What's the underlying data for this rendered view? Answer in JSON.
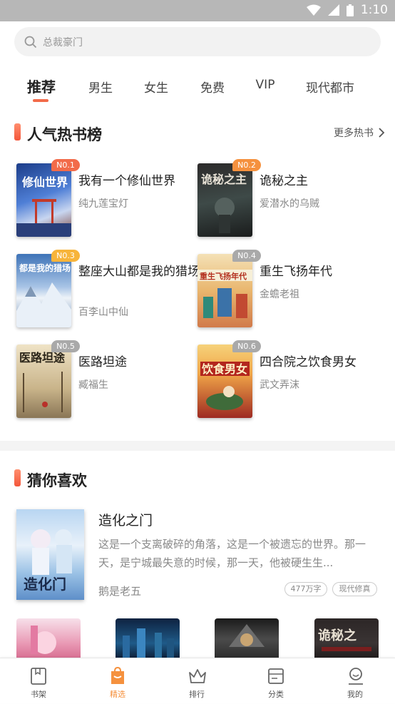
{
  "status_bar": {
    "time": "1:10"
  },
  "search": {
    "placeholder": "总裁豪门"
  },
  "tabs": [
    {
      "label": "推荐",
      "active": true
    },
    {
      "label": "男生"
    },
    {
      "label": "女生"
    },
    {
      "label": "免费"
    },
    {
      "label": "VIP"
    },
    {
      "label": "现代都市"
    }
  ],
  "hot_section": {
    "title": "人气热书榜",
    "more_label": "更多热书",
    "books": [
      {
        "rank": "N0.1",
        "title": "我有一个修仙世界",
        "author": "纯九莲宝灯",
        "badge_color": "#f26b4a"
      },
      {
        "rank": "N0.2",
        "title": "诡秘之主",
        "author": "爱潜水的乌贼",
        "badge_color": "#f5913e"
      },
      {
        "rank": "N0.3",
        "title": "整座大山都是我的猎场",
        "author": "百李山中仙",
        "badge_color": "#f7b43a"
      },
      {
        "rank": "N0.4",
        "title": "重生飞扬年代",
        "author": "金蟾老祖",
        "badge_color": "#a9a9a9"
      },
      {
        "rank": "N0.5",
        "title": "医路坦途",
        "author": "臧福生",
        "badge_color": "#a9a9a9"
      },
      {
        "rank": "N0.6",
        "title": "四合院之饮食男女",
        "author": "武文弄沫",
        "badge_color": "#a9a9a9"
      }
    ]
  },
  "guess_section": {
    "title": "猜你喜欢",
    "featured": {
      "title": "造化之门",
      "description": "这是一个支离破碎的角落，这是一个被遗忘的世界。那一天，是宁城最失意的时候，那一天，他被硬生生...",
      "author": "鹅是老五",
      "tags": [
        "477万字",
        "现代修真"
      ]
    }
  },
  "bottom_nav": [
    {
      "label": "书架",
      "icon": "bookshelf-icon"
    },
    {
      "label": "精选",
      "icon": "featured-icon",
      "active": true
    },
    {
      "label": "排行",
      "icon": "crown-icon"
    },
    {
      "label": "分类",
      "icon": "category-icon"
    },
    {
      "label": "我的",
      "icon": "profile-icon"
    }
  ],
  "colors": {
    "accent": "#f26b4a",
    "nav_active": "#f5913e",
    "nav_inactive": "#666666"
  }
}
